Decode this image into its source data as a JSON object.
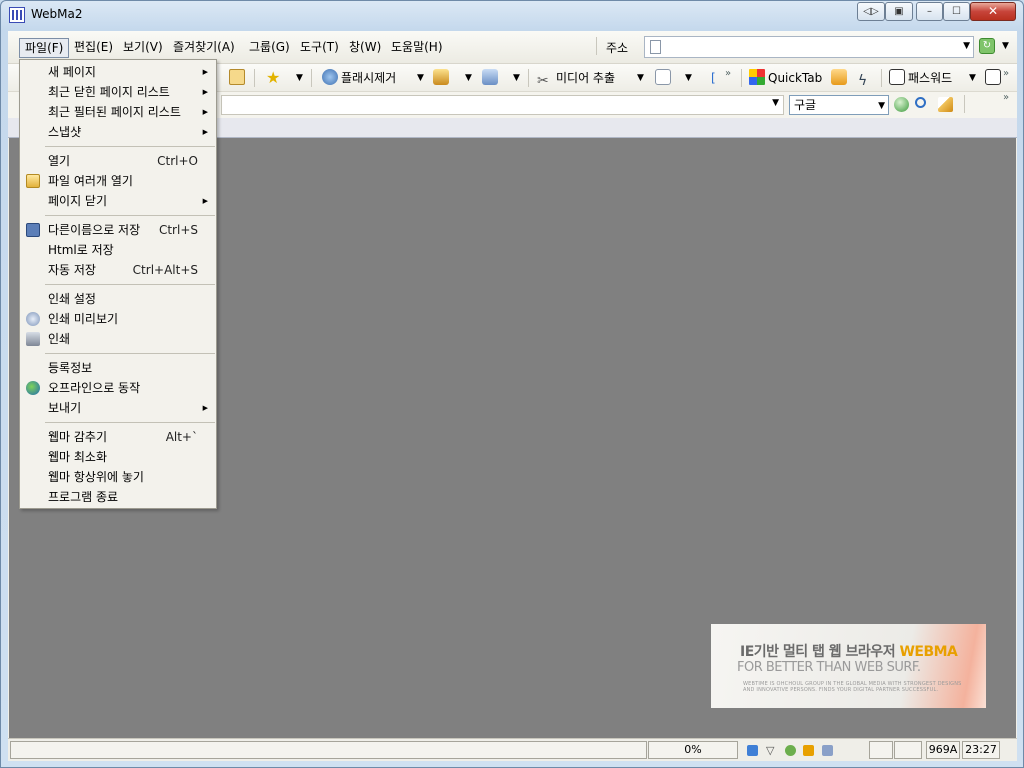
{
  "window": {
    "title": "WebMa2",
    "controls": {
      "minimize": "–",
      "maximize": "☐",
      "close": "✕",
      "extra1": "◁▷",
      "extra2": "▣"
    }
  },
  "menubar": {
    "items": [
      "파일(F)",
      "편집(E)",
      "보기(V)",
      "즐겨찾기(A)",
      "그룹(G)",
      "도구(T)",
      "창(W)",
      "도움말(H)"
    ]
  },
  "address": {
    "label": "주소",
    "value": ""
  },
  "toolbar": {
    "flash_remove": "플래시제거",
    "media_extract": "미디어 추출",
    "quicktab": "QuickTab",
    "password": "패스워드",
    "more": "»"
  },
  "search": {
    "query": "",
    "engine": "구글"
  },
  "file_menu": {
    "groups": [
      [
        {
          "label": "새 페이지",
          "shortcut": "",
          "submenu": true,
          "icon": ""
        },
        {
          "label": "최근 닫힌 페이지 리스트",
          "shortcut": "",
          "submenu": true,
          "icon": ""
        },
        {
          "label": "최근 필터된 페이지 리스트",
          "shortcut": "",
          "submenu": true,
          "icon": ""
        },
        {
          "label": "스냅샷",
          "shortcut": "",
          "submenu": true,
          "icon": ""
        }
      ],
      [
        {
          "label": "열기",
          "shortcut": "Ctrl+O",
          "submenu": false,
          "icon": ""
        },
        {
          "label": "파일 여러개 열기",
          "shortcut": "",
          "submenu": false,
          "icon": "folder-icon"
        },
        {
          "label": "페이지 닫기",
          "shortcut": "",
          "submenu": true,
          "icon": ""
        }
      ],
      [
        {
          "label": "다른이름으로 저장",
          "shortcut": "Ctrl+S",
          "submenu": false,
          "icon": "save-icon"
        },
        {
          "label": "Html로 저장",
          "shortcut": "",
          "submenu": false,
          "icon": ""
        },
        {
          "label": "자동 저장",
          "shortcut": "Ctrl+Alt+S",
          "submenu": false,
          "icon": ""
        }
      ],
      [
        {
          "label": "인쇄 설정",
          "shortcut": "",
          "submenu": false,
          "icon": ""
        },
        {
          "label": "인쇄 미리보기",
          "shortcut": "",
          "submenu": false,
          "icon": "print-preview-icon"
        },
        {
          "label": "인쇄",
          "shortcut": "",
          "submenu": false,
          "icon": "printer-icon"
        }
      ],
      [
        {
          "label": "등록정보",
          "shortcut": "",
          "submenu": false,
          "icon": ""
        },
        {
          "label": "오프라인으로 동작",
          "shortcut": "",
          "submenu": false,
          "icon": "globe-icon"
        },
        {
          "label": "보내기",
          "shortcut": "",
          "submenu": true,
          "icon": ""
        }
      ],
      [
        {
          "label": "웹마 감추기",
          "shortcut": "Alt+`",
          "submenu": false,
          "icon": ""
        },
        {
          "label": "웹마 최소화",
          "shortcut": "",
          "submenu": false,
          "icon": ""
        },
        {
          "label": "웹마 항상위에 놓기",
          "shortcut": "",
          "submenu": false,
          "icon": ""
        },
        {
          "label": "프로그램 종료",
          "shortcut": "",
          "submenu": false,
          "icon": ""
        }
      ]
    ]
  },
  "banner": {
    "line1_prefix": "IE기반 멀티 탭 웹 브라우저",
    "brand": "WEBMA",
    "line2": "FOR BETTER THAN WEB SURF.",
    "small1": "WEBTIME IS OHCHOUL GROUP IN THE GLOBAL MEDIA WITH STRONGEST DESIGNS",
    "small2": "AND INNOVATIVE PERSONS. FINDS YOUR DIGITAL PARTNER SUCCESSFUL."
  },
  "statusbar": {
    "progress": "0%",
    "memory": "969A",
    "time": "23:27"
  },
  "colors": {
    "content_bg": "#808080",
    "menu_bg": "#f3f2ec",
    "brand_accent": "#e8a000"
  }
}
